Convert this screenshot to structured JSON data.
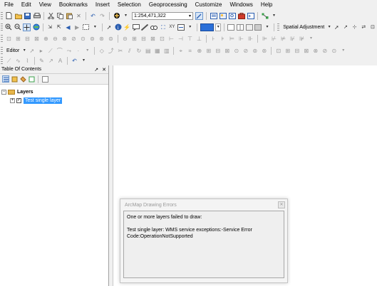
{
  "menu": [
    "File",
    "Edit",
    "View",
    "Bookmarks",
    "Insert",
    "Selection",
    "Geoprocessing",
    "Customize",
    "Windows",
    "Help"
  ],
  "toolbar": {
    "scale_value": "1:254,471,322",
    "spatial_adjustment_label": "Spatial Adjustment",
    "editor_label": "Editor"
  },
  "toc": {
    "title": "Table Of Contents",
    "pin_glyph": "↗",
    "close_glyph": "✕",
    "layers_group": "Layers",
    "layer_name": "Test single layer",
    "expander_minus": "−",
    "expander_plus": "+",
    "check_mark": "✓"
  },
  "dialog": {
    "title": "ArcMap Drawing Errors",
    "close_glyph": "✕",
    "line1": "One or more layers failed to draw:",
    "line2": "Test single layer:   WMS service exceptions:-Service Error",
    "line3": "Code:OperationNotSupported"
  }
}
